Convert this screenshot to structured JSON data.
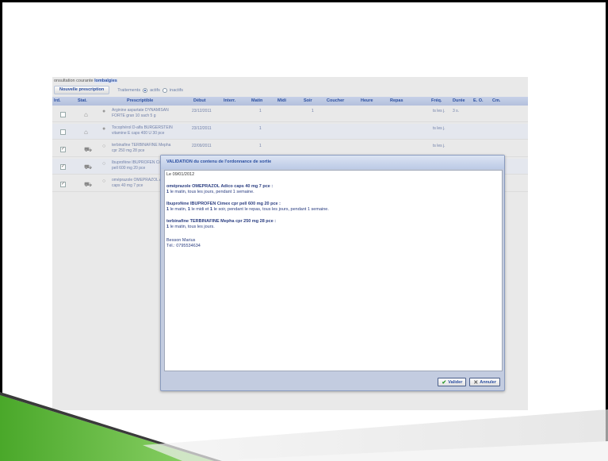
{
  "top": {
    "context_label": "onsultation courante",
    "context_value": "lombalgies"
  },
  "toolbar": {
    "new_prescription": "Nouvelle prescription",
    "treatments_label": "Traitements",
    "active_label": "actifs",
    "inactive_label": "inactifs"
  },
  "grid": {
    "headers": [
      "Ird.",
      "Stat.",
      "Prescriptible",
      "Début",
      "Interr.",
      "Matin",
      "Midi",
      "Soir",
      "Coucher",
      "Heure",
      "Repas",
      "Fréq.",
      "Durée",
      "E. O.",
      "Cm."
    ],
    "rows": [
      {
        "checked": false,
        "presc": "Arginine aspartate DYNAMISAN FORTE gran 10 sach 5 g",
        "debut": "23/12/2011",
        "matin": "1",
        "soir": "1",
        "freq": "ts les j.",
        "duree": "3 s."
      },
      {
        "checked": false,
        "presc": "Tocophérol D-alfa BURGERSTEIN vitamine E caps 400 U 30 pce",
        "debut": "23/12/2011",
        "matin": "1",
        "soir": "",
        "freq": "ts les j.",
        "duree": ""
      },
      {
        "checked": true,
        "presc": "terbinafine TERBINAFINE Mepha cpr 250 mg 28 pce",
        "debut": "22/09/2011",
        "matin": "1",
        "soir": "",
        "freq": "ts les j.",
        "duree": ""
      },
      {
        "checked": true,
        "presc": "Ibuprofène IBUPROFEN Cimex cpr pell 600 mg 20 pce",
        "debut": "",
        "matin": "",
        "soir": "",
        "freq": "",
        "duree": ""
      },
      {
        "checked": true,
        "presc": "oméprazole OMEPRAZOL Adico caps 40 mg 7 pce",
        "debut": "",
        "matin": "",
        "soir": "",
        "freq": "",
        "duree": ""
      }
    ]
  },
  "dialog": {
    "title": "VALIDATION du contenu de l'ordonnance de sortie",
    "date": "Le 09/01/2012",
    "entries": [
      {
        "drug": "oméprazole OMEPRAZOL Adico caps 40 mg 7 pce :",
        "dose_1": "1",
        "dose_text": " le matin, tous les jours, pendant 1 semaine."
      },
      {
        "drug": "Ibuprofène IBUPROFEN Cimex cpr pell 600 mg 20 pce :",
        "dose_1": "1",
        "dose_mid_a": " le matin, ",
        "dose_2": "1",
        "dose_mid_b": " le midi et ",
        "dose_3": "1",
        "dose_text": " le soir, pendant le repas, tous les jours, pendant 1 semaine."
      },
      {
        "drug": "terbinafine TERBINAFINE Mepha cpr 250 mg 28 pce :",
        "dose_1": "1",
        "dose_text": " le matin, tous les jours."
      }
    ],
    "signature_name": "Besson Marius",
    "signature_tel": "Tél.: 0795534634",
    "ok_label": "Valider",
    "cancel_label": "Annuler"
  },
  "colors": {
    "accent": "#2a4ea0",
    "deco_green": "#5cb82c"
  }
}
